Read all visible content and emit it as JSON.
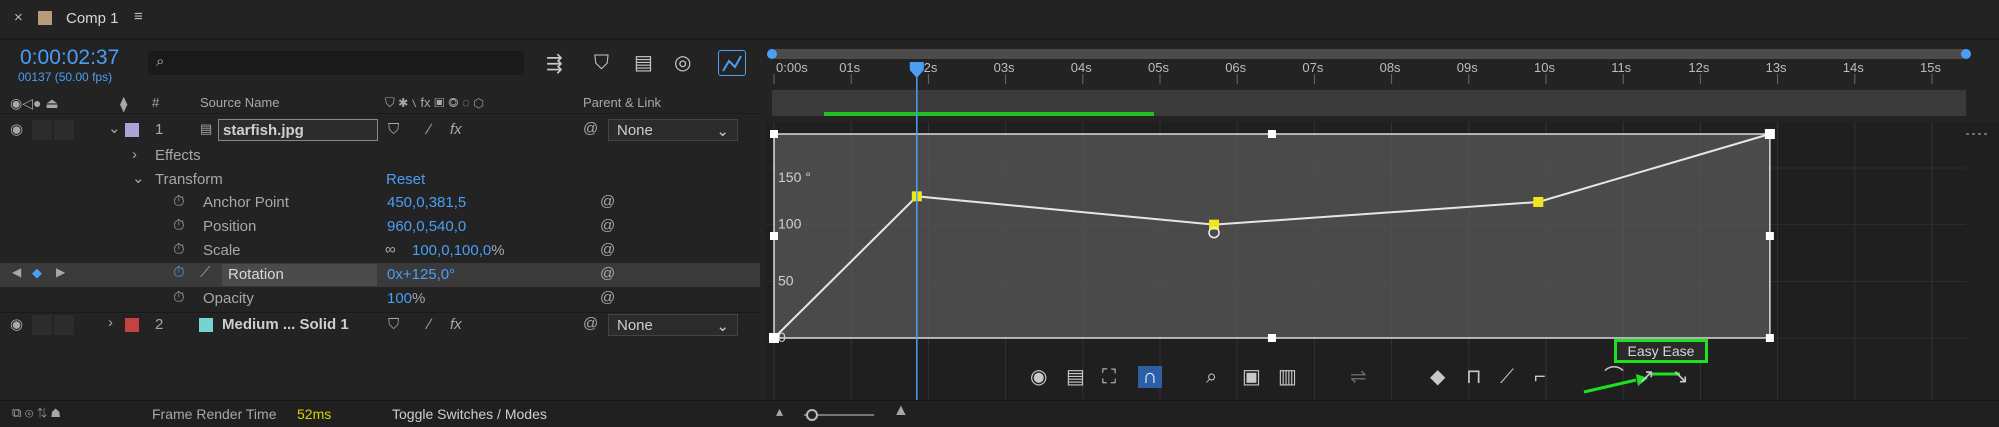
{
  "tab": {
    "close": "×",
    "title": "Comp 1",
    "menu": "≡"
  },
  "timecode": {
    "time": "0:00:02:37",
    "frames": "00137 (50.00 fps)"
  },
  "search": {
    "placeholder": ""
  },
  "columns": {
    "hash": "#",
    "source_name": "Source Name",
    "parent_link": "Parent & Link"
  },
  "layers": [
    {
      "index": "1",
      "name": "starfish.jpg",
      "parent": "None",
      "color": "#a9a3d6"
    },
    {
      "index": "2",
      "name": "Medium ... Solid 1",
      "parent": "None",
      "color": "#c4423f",
      "swatch": "#74d3d3"
    }
  ],
  "props": {
    "effects": "Effects",
    "transform": "Transform",
    "reset": "Reset",
    "anchor_label": "Anchor Point",
    "anchor_value": "450,0,381,5",
    "position_label": "Position",
    "position_value": "960,0,540,0",
    "scale_label": "Scale",
    "scale_value": "100,0,100,0",
    "scale_unit": "%",
    "rotation_label": "Rotation",
    "rotation_value": "0x+125,0°",
    "opacity_label": "Opacity",
    "opacity_value": "100",
    "opacity_unit": "%"
  },
  "ruler": [
    "0:00s",
    "01s",
    "02s",
    "03s",
    "04s",
    "05s",
    "06s",
    "07s",
    "08s",
    "09s",
    "10s",
    "11s",
    "12s",
    "13s",
    "14s",
    "15s"
  ],
  "graph_labels": [
    "150 °",
    "100",
    "50",
    "0"
  ],
  "keyframes_deg": [
    0,
    125,
    100,
    120,
    180
  ],
  "keyframe_times_s": [
    0,
    1.85,
    5.7,
    9.9,
    12.9
  ],
  "current_time_s": 1.85,
  "tooltip": "Easy Ease",
  "footer": {
    "frame_render_label": "Frame Render Time",
    "frame_render_value": "52ms",
    "toggle": "Toggle Switches / Modes"
  },
  "colors": {
    "accent": "#4a9ff5",
    "highlight": "#1fe01f",
    "keyframe": "#f2e61b"
  }
}
